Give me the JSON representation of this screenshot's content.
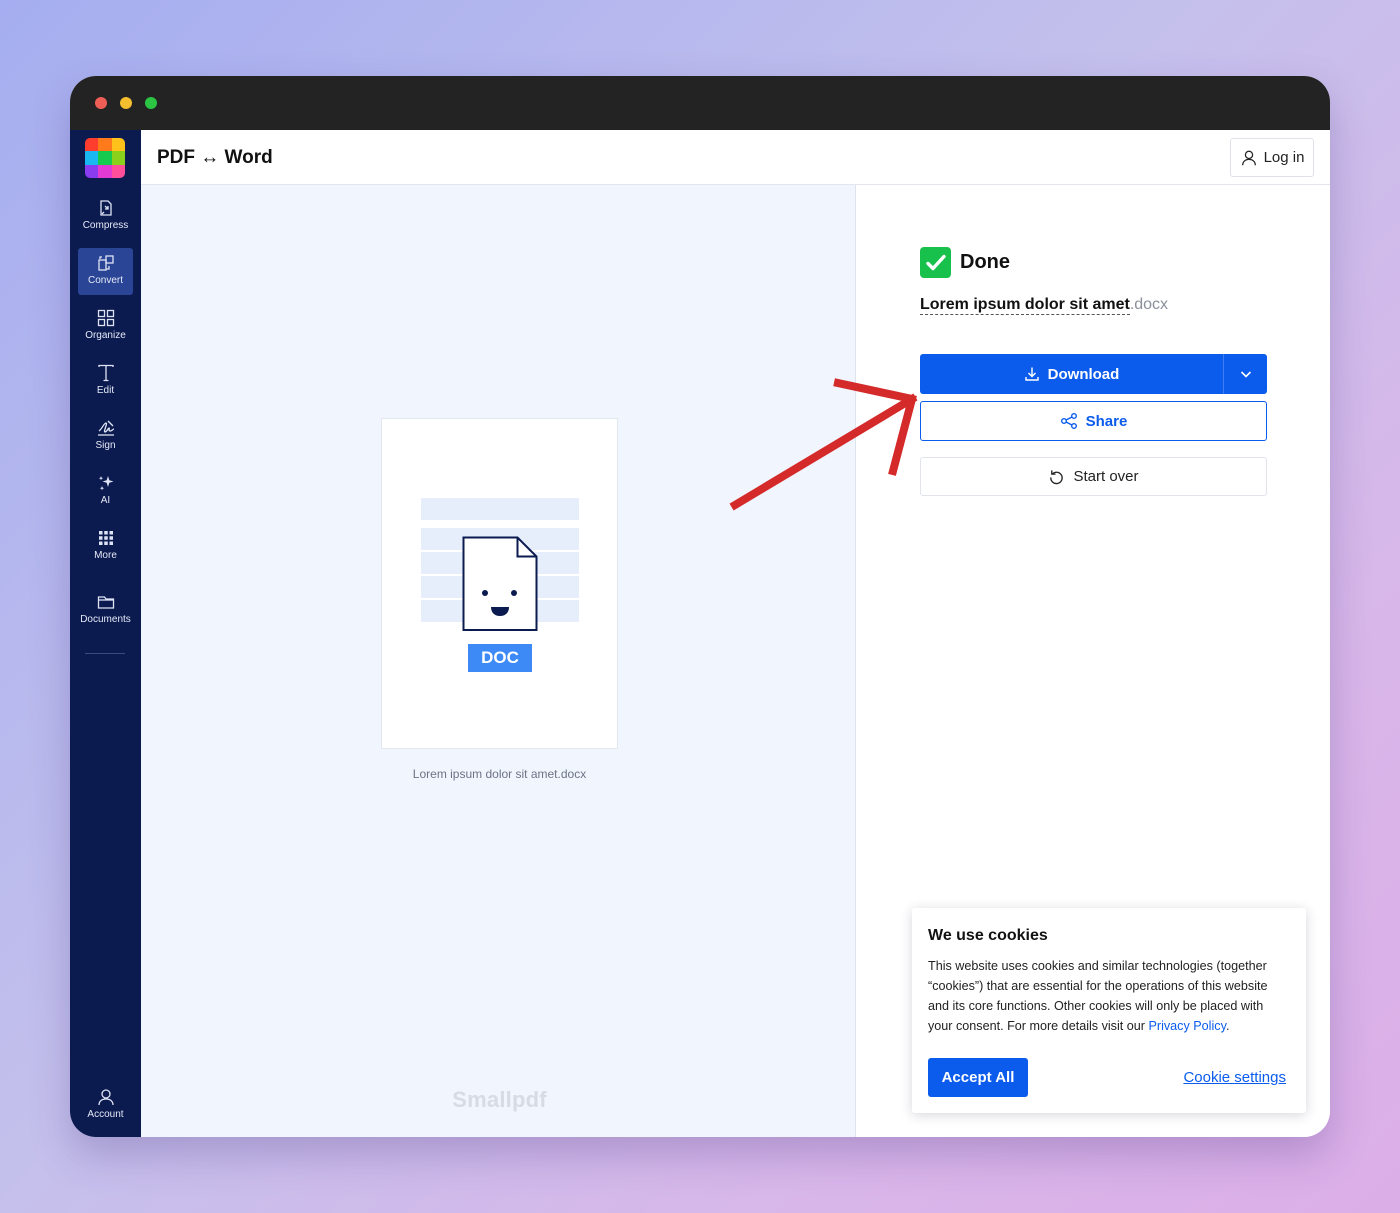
{
  "header": {
    "title": "PDF ↔ Word",
    "login_label": "Log in"
  },
  "sidebar": {
    "items": [
      {
        "label": "Compress",
        "icon": "compress-icon"
      },
      {
        "label": "Convert",
        "icon": "convert-icon",
        "active": true
      },
      {
        "label": "Organize",
        "icon": "organize-icon"
      },
      {
        "label": "Edit",
        "icon": "edit-text-icon"
      },
      {
        "label": "Sign",
        "icon": "signature-icon"
      },
      {
        "label": "AI",
        "icon": "sparkles-icon"
      },
      {
        "label": "More",
        "icon": "grid-dots-icon"
      },
      {
        "label": "Documents",
        "icon": "folder-icon"
      }
    ],
    "account_label": "Account"
  },
  "preview": {
    "badge": "DOC",
    "caption": "Lorem ipsum dolor sit amet.docx",
    "watermark": "Smallpdf"
  },
  "result": {
    "status": "Done",
    "file_name": "Lorem ipsum dolor sit amet",
    "file_ext": ".docx",
    "download_label": "Download",
    "share_label": "Share",
    "start_over_label": "Start over"
  },
  "cookie": {
    "title": "We use cookies",
    "body": "This website uses cookies and similar technologies (together “cookies”) that are essential for the operations of this website and its core functions. Other cookies will only be placed with your consent. For more details visit our",
    "link": "Privacy Policy",
    "body_end": ".",
    "accept_label": "Accept All",
    "settings_label": "Cookie settings"
  },
  "colors": {
    "sidebar_bg": "#0b1a4f",
    "sidebar_active": "#2a4596",
    "primary": "#0b5ced",
    "success": "#18c04c",
    "doc_badge": "#3d8af7",
    "annotation_arrow": "#d42a2a"
  }
}
